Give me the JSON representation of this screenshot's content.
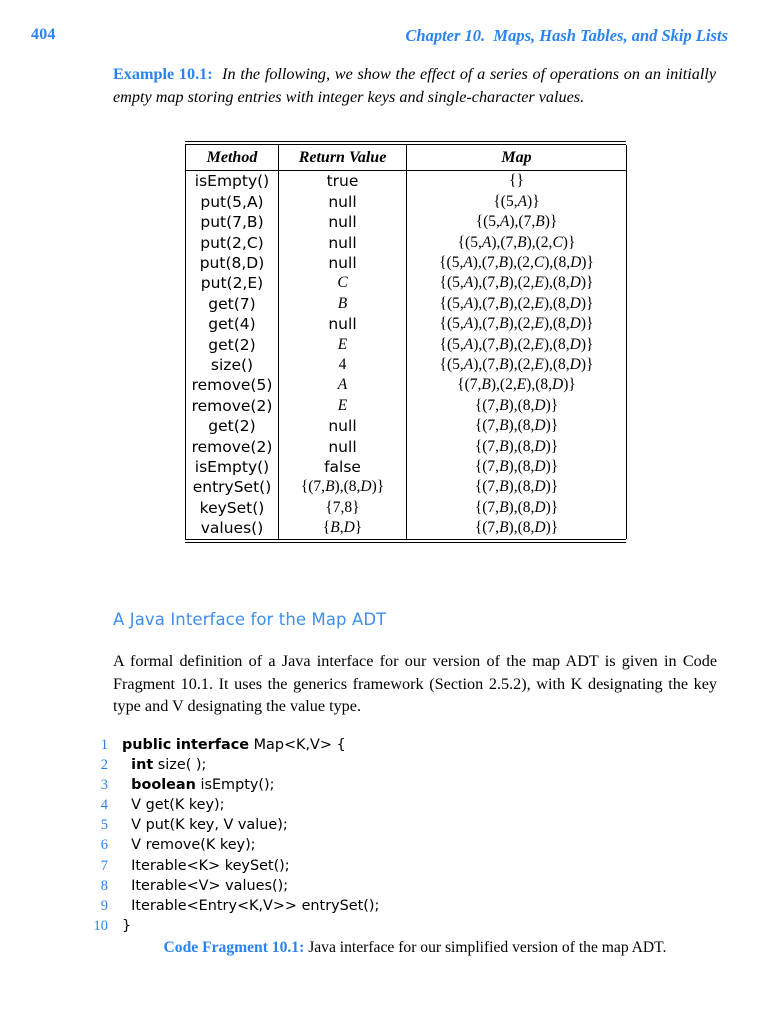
{
  "page": {
    "folio": "404",
    "chapter_title": "Chapter 10.  Maps, Hash Tables, and Skip Lists"
  },
  "example": {
    "label": "Example 10.1:",
    "text": "In the following, we show the effect of a series of operations on an initially empty map storing entries with integer keys and single-character values."
  },
  "table": {
    "headers": [
      "Method",
      "Return Value",
      "Map"
    ],
    "rows": [
      {
        "method": "isEmpty()",
        "return": "true",
        "map": "{}"
      },
      {
        "method": "put(5,A)",
        "return": "null",
        "map": "{(5,A)}"
      },
      {
        "method": "put(7,B)",
        "return": "null",
        "map": "{(5,A),(7,B)}"
      },
      {
        "method": "put(2,C)",
        "return": "null",
        "map": "{(5,A),(7,B),(2,C)}"
      },
      {
        "method": "put(8,D)",
        "return": "null",
        "map": "{(5,A),(7,B),(2,C),(8,D)}"
      },
      {
        "method": "put(2,E)",
        "return": "C",
        "map": "{(5,A),(7,B),(2,E),(8,D)}"
      },
      {
        "method": "get(7)",
        "return": "B",
        "map": "{(5,A),(7,B),(2,E),(8,D)}"
      },
      {
        "method": "get(4)",
        "return": "null",
        "map": "{(5,A),(7,B),(2,E),(8,D)}"
      },
      {
        "method": "get(2)",
        "return": "E",
        "map": "{(5,A),(7,B),(2,E),(8,D)}"
      },
      {
        "method": "size()",
        "return": "4",
        "map": "{(5,A),(7,B),(2,E),(8,D)}"
      },
      {
        "method": "remove(5)",
        "return": "A",
        "map": "{(7,B),(2,E),(8,D)}"
      },
      {
        "method": "remove(2)",
        "return": "E",
        "map": "{(7,B),(8,D)}"
      },
      {
        "method": "get(2)",
        "return": "null",
        "map": "{(7,B),(8,D)}"
      },
      {
        "method": "remove(2)",
        "return": "null",
        "map": "{(7,B),(8,D)}"
      },
      {
        "method": "isEmpty()",
        "return": "false",
        "map": "{(7,B),(8,D)}"
      },
      {
        "method": "entrySet()",
        "return": "{(7,B),(8,D)}",
        "map": "{(7,B),(8,D)}"
      },
      {
        "method": "keySet()",
        "return": "{7,8}",
        "map": "{(7,B),(8,D)}"
      },
      {
        "method": "values()",
        "return": "{B,D}",
        "map": "{(7,B),(8,D)}"
      }
    ]
  },
  "subsection": {
    "heading": "A Java Interface for the Map ADT",
    "paragraph": "A formal definition of a Java interface for our version of the map ADT is given in Code Fragment 10.1. It uses the generics framework (Section 2.5.2), with K designating the key type and V designating the value type."
  },
  "code": {
    "lines": [
      {
        "no": "1",
        "text": "public interface Map<K,V> {"
      },
      {
        "no": "2",
        "text": "  int size( );"
      },
      {
        "no": "3",
        "text": "  boolean isEmpty();"
      },
      {
        "no": "4",
        "text": "  V get(K key);"
      },
      {
        "no": "5",
        "text": "  V put(K key, V value);"
      },
      {
        "no": "6",
        "text": "  V remove(K key);"
      },
      {
        "no": "7",
        "text": "  Iterable<K> keySet();"
      },
      {
        "no": "8",
        "text": "  Iterable<V> values();"
      },
      {
        "no": "9",
        "text": "  Iterable<Entry<K,V>> entrySet();"
      },
      {
        "no": "10",
        "text": "}"
      }
    ]
  },
  "caption": {
    "label": "Code Fragment 10.1:",
    "text": "Java interface for our simplified version of the map ADT."
  },
  "colors": {
    "accent_blue": "#2a84ef",
    "heading_blue": "#3d8ff0",
    "text_black": "#000000"
  }
}
